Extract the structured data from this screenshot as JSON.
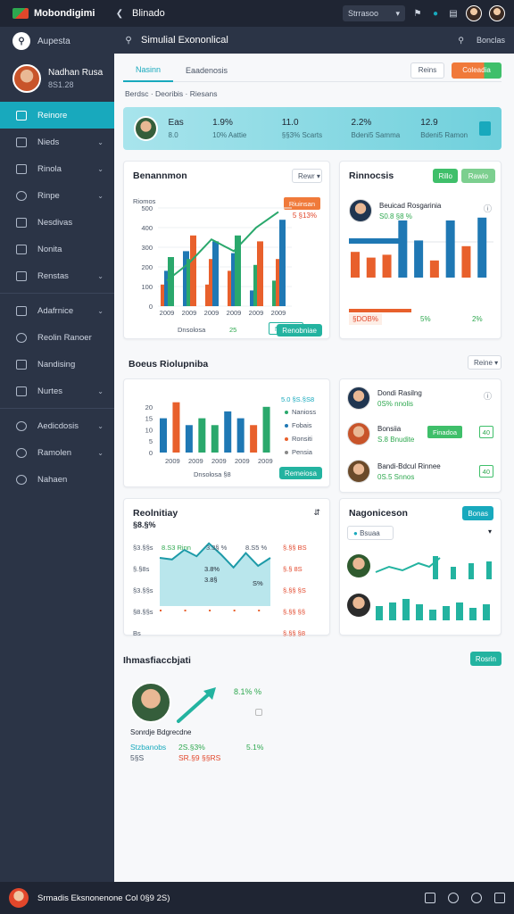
{
  "app": {
    "title": "Mobondigimi",
    "brand_colors": [
      "#2ea84f",
      "#e2472b"
    ]
  },
  "topbar": {
    "back_label": "Blinado",
    "dropdown": "Strrasoo",
    "badge": "2"
  },
  "sidebar": {
    "search_label": "Aupesta",
    "profile": {
      "name": "Nadhan Rusa",
      "sub": "8S1.28"
    },
    "items": [
      {
        "label": "Reinore",
        "icon": "square-icon",
        "active": true,
        "chevron": false
      },
      {
        "label": "Nieds",
        "icon": "square-icon",
        "chevron": true
      },
      {
        "label": "Rinola",
        "icon": "square-icon",
        "chevron": true
      },
      {
        "label": "Rinpe",
        "icon": "gear-icon",
        "chevron": true
      },
      {
        "label": "Nesdivas",
        "icon": "settings-icon",
        "chevron": false
      },
      {
        "label": "Nonita",
        "icon": "square-icon",
        "chevron": false
      },
      {
        "label": "Renstas",
        "icon": "square-icon",
        "chevron": true
      },
      {
        "label": "Adafrnice",
        "icon": "people-icon",
        "chevron": true
      },
      {
        "label": "Reolin Ranoer",
        "icon": "clock-icon",
        "chevron": false
      },
      {
        "label": "Nandising",
        "icon": "grid-icon",
        "chevron": false
      },
      {
        "label": "Nurtes",
        "icon": "grid-icon",
        "chevron": true
      },
      {
        "label": "Aedicdosis",
        "icon": "cog-icon",
        "chevron": true
      },
      {
        "label": "Ramolen",
        "icon": "cog-icon",
        "chevron": true
      },
      {
        "label": "Nahaen",
        "icon": "gear-icon",
        "chevron": false
      }
    ]
  },
  "header": {
    "title": "Simulial Exononlical",
    "right_label": "Bonclas"
  },
  "tabs": {
    "items": [
      "Nasinn",
      "Eaadenosis"
    ],
    "btn_ghost": "Reins",
    "btn_orange": "Coleadia"
  },
  "breadcrumb": "Berdsc · Deoribis · Riesans",
  "kpi": {
    "cells": [
      {
        "value": "Eas",
        "label": "8.0"
      },
      {
        "value": "1.9%",
        "label": "10% Aattie"
      },
      {
        "value": "11.0",
        "label": "§§3% Scarts"
      },
      {
        "value": "2.2%",
        "label": "Bdeni5 Samma"
      },
      {
        "value": "12.9",
        "label": "Bdeni5 Ramon"
      }
    ]
  },
  "card1": {
    "title": "Benannmon",
    "select": "Rewr",
    "ylabel": "Riomos",
    "badge": "Riuinsan",
    "pct": "5 §13%",
    "legend_label": "Dnsolosa",
    "legend_value": "25",
    "btn_small": "Nanonli",
    "btn": "Renobniae"
  },
  "card2": {
    "title": "Rinnocsis",
    "btn_a": "Rillo",
    "btn_b": "Rawio",
    "person": {
      "name": "Beuicad Rosgarinia",
      "value": "S0.8 §8 %"
    },
    "foot": [
      "§DOB%",
      "5%",
      "2%"
    ]
  },
  "card3": {
    "title": "Boeus Riolupniba",
    "select": "Reine",
    "legend_top": "5.0 §S.§S8",
    "legend": [
      "Nanioss",
      "Fobais",
      "Ronsiti",
      "Pensia"
    ],
    "foot_label": "Dnsolosa §8",
    "btn": "Remeiosa",
    "people": [
      {
        "name": "Dondi Rasilng",
        "value": "0S% nnolis"
      },
      {
        "name": "Bonsiia",
        "value": "S.8 Bnudite",
        "chip": "Finadoa",
        "chip2": "40"
      },
      {
        "name": "Bandi-Bdcul Rinnee",
        "value": "0S.5 Snnos",
        "chip2": "40"
      }
    ]
  },
  "card4": {
    "title": "Reolnitiay",
    "sub": "§8.§%",
    "top_labels": [
      "8.S3 Rinn",
      "3.3§ %",
      "8.S5 %"
    ],
    "mid": [
      "3.8%",
      "3.8§",
      "S%"
    ],
    "ylabels": [
      "§3.§§s",
      "§.§8s",
      "§3.§§s",
      "§8.§§s",
      "Bs"
    ],
    "right": [
      "§.§§ BS",
      "§.§ 8S",
      "§.§§ §S",
      "§.§§ §§",
      "§.§§ §8"
    ]
  },
  "card5": {
    "title": "Nagoniceson",
    "btn": "Bonas",
    "select": "Bsuaa"
  },
  "card6": {
    "title": "Ihmasfiaccbjati",
    "btn": "Rosrin",
    "pct": "8.1% %",
    "name": "Sonrdje Bdgrecdne",
    "foot": [
      "Stzbanobs",
      "2S.§3%",
      "5.1%"
    ],
    "foot2": [
      "5§S",
      "SR.§9 §§RS"
    ]
  },
  "footer": {
    "text": "Srmadis Eksnonenone Col 0§9 2S)"
  },
  "chart_data": [
    {
      "type": "bar",
      "title": "Benannmon",
      "categories": [
        "2009",
        "2009",
        "2009",
        "2009",
        "2009",
        "2009"
      ],
      "ylim": [
        0,
        500
      ],
      "series": [
        {
          "values": [
            110,
            280,
            110,
            180,
            80,
            130
          ]
        },
        {
          "values": [
            180,
            240,
            240,
            270,
            210,
            240
          ]
        },
        {
          "values": [
            250,
            360,
            330,
            360,
            330,
            440
          ]
        }
      ],
      "line": [
        130,
        220,
        340,
        280,
        400,
        480
      ]
    },
    {
      "type": "bar",
      "title": "Boeus Riolupniba",
      "ylim": [
        0,
        25
      ],
      "ticks": [
        "20",
        "15",
        "10",
        "5",
        "0"
      ],
      "values": [
        15,
        22,
        12,
        15,
        12,
        18,
        15,
        12,
        20
      ],
      "colors": [
        "#1f78b4",
        "#e8602c",
        "#1f78b4",
        "#2aa86c",
        "#2aa86c",
        "#1f78b4",
        "#1f78b4",
        "#e8602c",
        "#2aa86c"
      ],
      "categories": [
        "2009",
        "2009",
        "2009",
        "2009",
        "2009"
      ]
    },
    {
      "type": "area",
      "title": "Reolnitiay",
      "x": [
        "1",
        "2",
        "3",
        "4",
        "5",
        "6",
        "7",
        "8",
        "9",
        "10"
      ],
      "values": [
        60,
        58,
        70,
        62,
        78,
        64,
        48,
        66,
        50,
        60
      ]
    },
    {
      "type": "bar",
      "title": "Rinnocsis",
      "values": [
        18,
        14,
        16,
        40,
        26,
        12,
        40,
        22,
        42
      ]
    }
  ]
}
